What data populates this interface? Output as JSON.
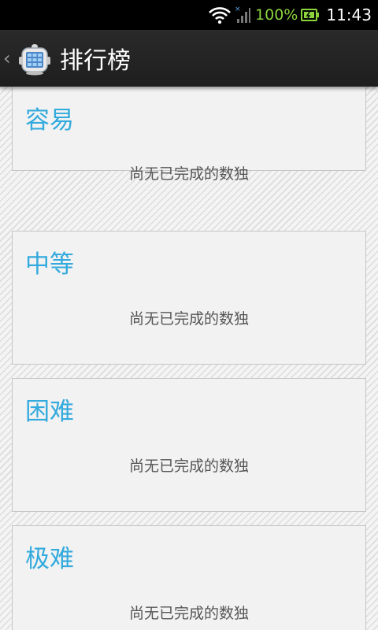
{
  "status_bar": {
    "battery": "100%",
    "time": "11:43",
    "icons": [
      "wifi-icon",
      "signal-icon",
      "battery-charging-icon"
    ]
  },
  "action_bar": {
    "title": "排行榜",
    "icons": [
      "back-chevron-icon",
      "app-icon"
    ]
  },
  "leaderboard": {
    "sections": [
      {
        "title": "容易",
        "message": "尚无已完成的数独"
      },
      {
        "title": "中等",
        "message": "尚无已完成的数独"
      },
      {
        "title": "困难",
        "message": "尚无已完成的数独"
      },
      {
        "title": "极难",
        "message": "尚无已完成的数独"
      }
    ]
  },
  "colors": {
    "accent": "#33aadd",
    "battery": "#8cd43c",
    "action_bar": "#222222"
  }
}
